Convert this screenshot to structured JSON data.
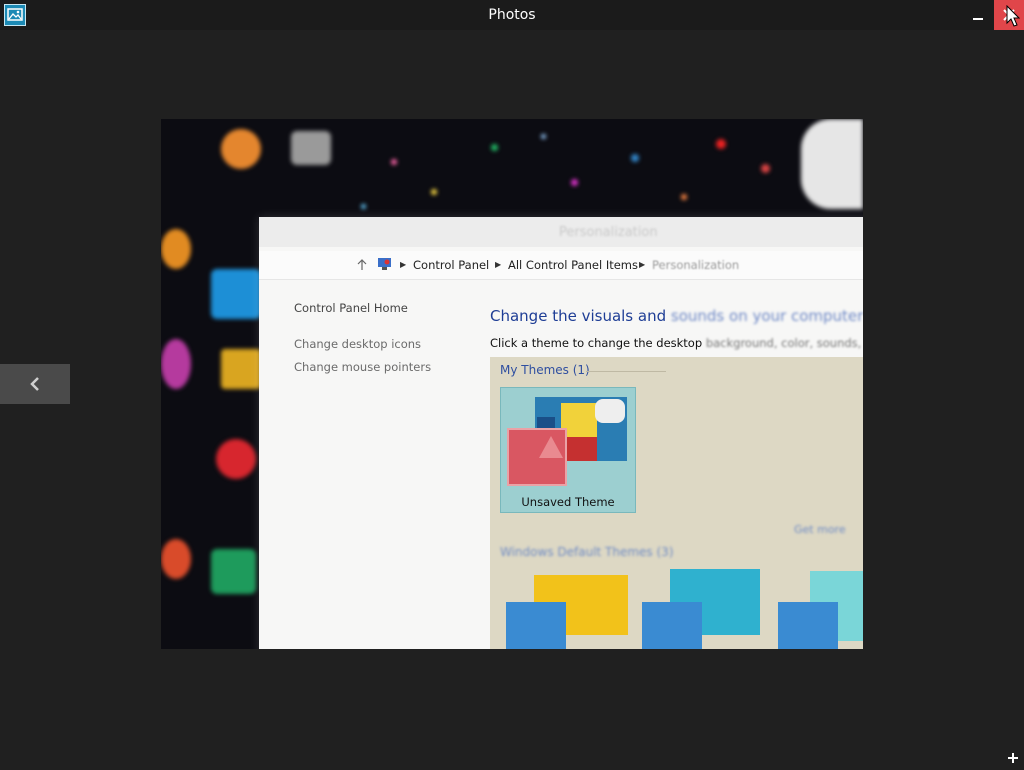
{
  "window": {
    "title": "Photos",
    "icons": {
      "app": "photos-app-icon",
      "minimize": "minimize-icon",
      "close": "close-icon",
      "prev": "chevron-left-icon",
      "add": "plus-icon"
    },
    "close_color": "#e0464a"
  },
  "photo": {
    "control_panel": {
      "title": "Personalization",
      "breadcrumbs": [
        "Control Panel",
        "All Control Panel Items",
        "Personalization"
      ],
      "sidebar": {
        "home": "Control Panel Home",
        "link1_sharp": "Change desktop icons",
        "link2_sharp": "Change mouse pointers"
      },
      "heading_sharp": "Change the visuals and",
      "heading_blurred": "sounds on your computer",
      "subtext_sharp": "Click a theme to change the desktop",
      "subtext_blurred": "background, color, sounds, and s",
      "my_themes_label": "My Themes (1)",
      "theme_name": "Unsaved Theme",
      "get_more_link": "Get more",
      "default_themes_label": "Windows Default Themes (3)"
    }
  }
}
